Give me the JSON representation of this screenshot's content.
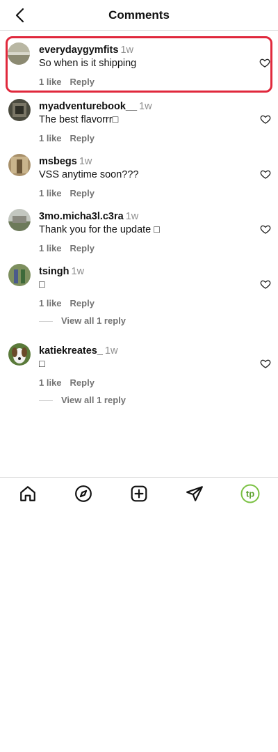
{
  "header": {
    "title": "Comments"
  },
  "comments": [
    {
      "username": "everydaygymfits",
      "time": "1w",
      "text": "So when is it shipping",
      "likes": "1 like",
      "reply": "Reply"
    },
    {
      "username": "myadventurebook__",
      "time": "1w",
      "text": "The best flavorrr□",
      "likes": "1 like",
      "reply": "Reply"
    },
    {
      "username": "msbegs",
      "time": "1w",
      "text": "VSS anytime soon???",
      "likes": "1 like",
      "reply": "Reply"
    },
    {
      "username": "3mo.micha3l.c3ra",
      "time": "1w",
      "text": "Thank you for the update □",
      "likes": "1 like",
      "reply": "Reply"
    },
    {
      "username": "tsingh",
      "time": "1w",
      "text": "□",
      "likes": "1 like",
      "reply": "Reply",
      "view_replies": "View all 1 reply"
    },
    {
      "username": "katiekreates_",
      "time": "1w",
      "text": "□",
      "likes": "1 like",
      "reply": "Reply",
      "view_replies": "View all 1 reply"
    }
  ],
  "tabs": [
    {
      "icon": "home-icon"
    },
    {
      "icon": "explore-compass-icon"
    },
    {
      "icon": "create-plus-icon"
    },
    {
      "icon": "direct-send-icon"
    },
    {
      "icon": "profile-avatar-icon",
      "avatar_text": "tp"
    }
  ],
  "colors": {
    "highlight": "#e0283c",
    "muted": "#737373",
    "profile_ring": "#7ac142"
  }
}
